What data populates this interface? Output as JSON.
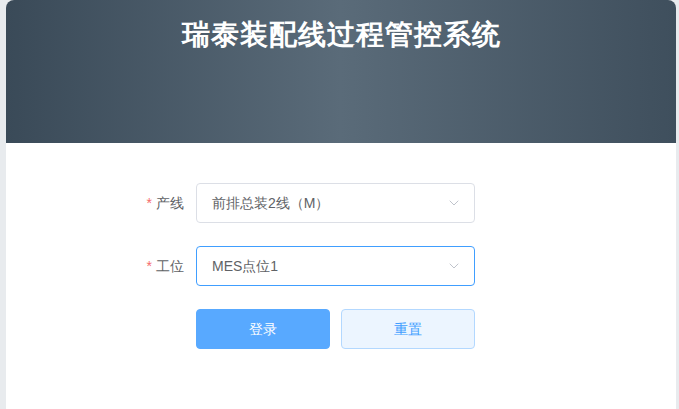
{
  "header": {
    "title": "瑞泰装配线过程管控系统"
  },
  "fields": [
    {
      "label": "产线",
      "required": true,
      "required_mark": "*",
      "value": "前排总装2线（M）",
      "focused": false
    },
    {
      "label": "工位",
      "required": true,
      "required_mark": "*",
      "value": "MES点位1",
      "focused": true
    }
  ],
  "buttons": [
    {
      "label": "登录",
      "kind": "primary"
    },
    {
      "label": "重置",
      "kind": "plain"
    }
  ]
}
